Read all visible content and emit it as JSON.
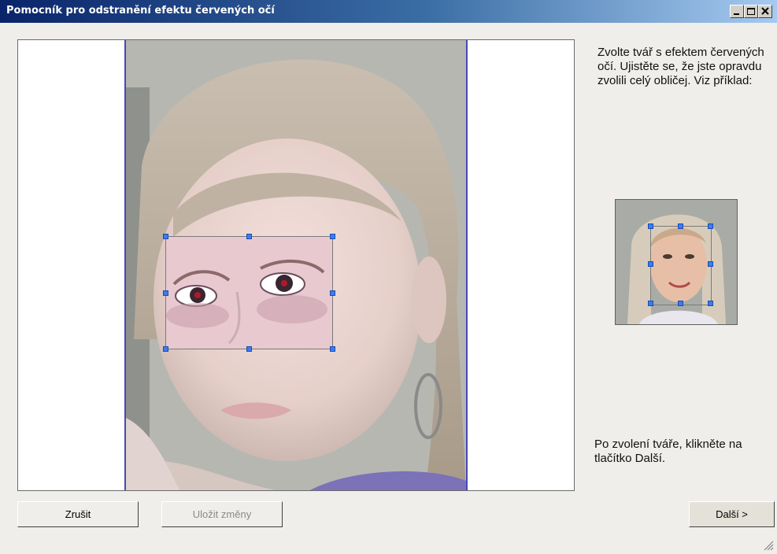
{
  "window": {
    "title": "Pomocník pro odstranění efektu červených očí",
    "controls": {
      "minimize_icon": "minimize-icon",
      "maximize_icon": "maximize-icon",
      "close_icon": "close-icon"
    }
  },
  "instructions": {
    "top_text": "Zvolte tvář s efektem červených očí. Ujistěte se, že jste opravdu zvolili celý obličej. Viz příklad:",
    "bottom_text": "Po zvolení tváře, klikněte na tlačítko Další."
  },
  "buttons": {
    "cancel": "Zrušit",
    "save": "Uložit změny",
    "next": "Další >"
  },
  "colors": {
    "title_gradient_start": "#0a246a",
    "title_gradient_end": "#a6caf0",
    "selection_handle": "#3c7cf0",
    "disabled_text": "#8a8a8a"
  }
}
